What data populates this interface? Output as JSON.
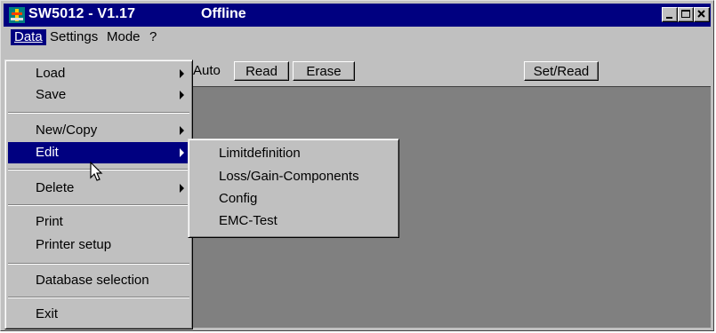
{
  "window": {
    "title": "SW5012 - V1.17",
    "status": "Offline",
    "colors": {
      "titlebar": "#000080",
      "face": "#c0c0c0",
      "workarea": "#808080"
    }
  },
  "menubar": {
    "items": [
      "Data",
      "Settings",
      "Mode",
      "?"
    ]
  },
  "toolbar": {
    "auto_label": "Auto",
    "read_label": "Read",
    "erase_label": "Erase",
    "setread_label": "Set/Read"
  },
  "data_menu": {
    "items": [
      {
        "label": "Load",
        "submenu": true
      },
      {
        "label": "Save",
        "submenu": true
      },
      {
        "label": "New/Copy",
        "submenu": true
      },
      {
        "label": "Edit",
        "submenu": true,
        "selected": true
      },
      {
        "label": "Delete",
        "submenu": true
      },
      {
        "label": "Print"
      },
      {
        "label": "Printer setup"
      },
      {
        "label": "Database selection"
      },
      {
        "label": "Exit"
      }
    ]
  },
  "edit_submenu": {
    "items": [
      "Limitdefinition",
      "Loss/Gain-Components",
      "Config",
      "EMC-Test"
    ]
  }
}
